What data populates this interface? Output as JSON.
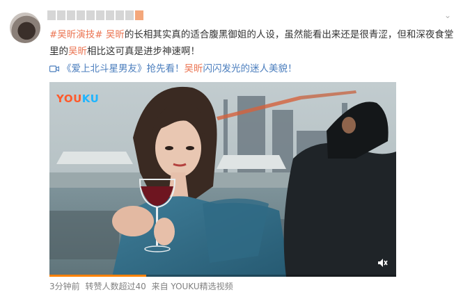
{
  "post": {
    "hashtag": "#吴昕演技#",
    "mention": "吴昕",
    "text_1": "的长相其实真的适合腹黑御姐的人设，虽然能看出来还是很青涩，但和深夜食堂里的",
    "mention_2": "吴昕",
    "text_2": "相比这可真是进步神速啊！"
  },
  "video_link": {
    "title": "《爱上北斗星男友》",
    "text": "抢先看！",
    "mention": "吴昕",
    "text_2": "闪闪发光的迷人美貌！"
  },
  "video": {
    "logo_you": "YOU",
    "logo_ku": "KU",
    "progress": 0.28,
    "mute_icon": "mute-icon"
  },
  "meta": {
    "time": "3分钟前",
    "shares": "转赞人数超过40",
    "source": "来自 YOUKU精选视频"
  },
  "colors": {
    "link": "#eb7350",
    "blue": "#4a7dbd",
    "progress": "#ff8200"
  }
}
